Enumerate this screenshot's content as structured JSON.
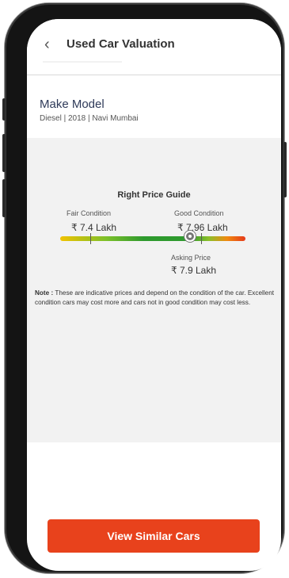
{
  "header": {
    "title": "Used Car Valuation",
    "back_icon": "chevron-left-icon"
  },
  "car": {
    "model": "Make Model",
    "meta": "Diesel | 2018 | Navi Mumbai"
  },
  "price_guide": {
    "title": "Right Price Guide",
    "fair": {
      "label": "Fair Condition",
      "price": "₹ 7.4 Lakh"
    },
    "good": {
      "label": "Good Condition",
      "price": "₹ 7.96 Lakh"
    },
    "asking": {
      "label": "Asking Price",
      "price": "₹ 7.9 Lakh"
    },
    "colors": {
      "low": "#f2c200",
      "mid": "#2e9a2e",
      "high": "#e53a1a"
    }
  },
  "note": {
    "prefix": "Note :",
    "text": " These are indicative prices and depend on the condition of the car. Excellent condition cars may cost more and cars not in good condition may cost less."
  },
  "cta": {
    "label": "View Similar Cars",
    "color": "#e8421c"
  }
}
